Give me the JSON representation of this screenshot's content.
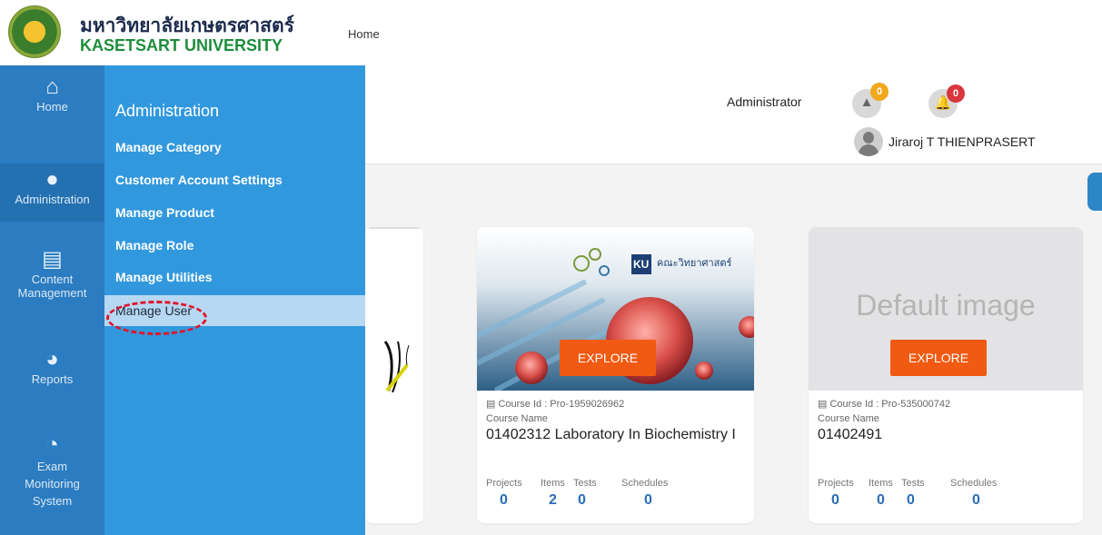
{
  "header": {
    "logo_th": "มหาวิทยาลัยเกษตรศาสตร์",
    "logo_en": "KASETSART UNIVERSITY",
    "breadcrumb": "Home"
  },
  "user_bar": {
    "role": "Administrator",
    "alerts_count": "0",
    "notifications_count": "0",
    "user_name": "Jiraroj  T THIENPRASERT"
  },
  "sidebar": {
    "items": [
      {
        "label": "Home",
        "icon": "home-icon"
      },
      {
        "label": "Administration",
        "icon": "user-icon"
      },
      {
        "label": "Content Management",
        "icon": "document-icon"
      },
      {
        "label": "Reports",
        "icon": "pie-chart-icon"
      },
      {
        "label": "Exam Monitoring System",
        "icon": "dashboard-icon"
      }
    ]
  },
  "submenu": {
    "title": "Administration",
    "items": [
      {
        "label": "Manage Category"
      },
      {
        "label": "Customer Account Settings"
      },
      {
        "label": "Manage Product"
      },
      {
        "label": "Manage Role"
      },
      {
        "label": "Manage Utilities"
      },
      {
        "label": "Manage User"
      }
    ]
  },
  "cards": [
    {
      "explore_label": "EXPLORE",
      "course_id": "Course Id : Pro-1959026962",
      "course_label": "Course Name",
      "course_name": "01402312 Laboratory In Biochemistry I",
      "banner_text": "คณะวิทยาศาสตร์",
      "banner_logo": "KU",
      "stats": [
        {
          "label": "Projects",
          "value": "0"
        },
        {
          "label": "Items",
          "value": "2"
        },
        {
          "label": "Tests",
          "value": "0"
        },
        {
          "label": "Schedules",
          "value": "0"
        }
      ]
    },
    {
      "explore_label": "EXPLORE",
      "default_image_text": "Default image",
      "course_id": "Course Id : Pro-535000742",
      "course_label": "Course Name",
      "course_name": "01402491",
      "stats": [
        {
          "label": "Projects",
          "value": "0"
        },
        {
          "label": "Items",
          "value": "0"
        },
        {
          "label": "Tests",
          "value": "0"
        },
        {
          "label": "Schedules",
          "value": "0"
        }
      ]
    }
  ],
  "colors": {
    "sidebar_bg": "#2b7cc0",
    "submenu_bg": "#3298de",
    "highlight_bg": "#b7d8f2",
    "explore_bg": "#f15a12",
    "stat_value": "#2a6db5",
    "alert_badge": "#f0a81c",
    "notification_badge": "#d9363e",
    "annotation_oval": "#e0142a"
  }
}
